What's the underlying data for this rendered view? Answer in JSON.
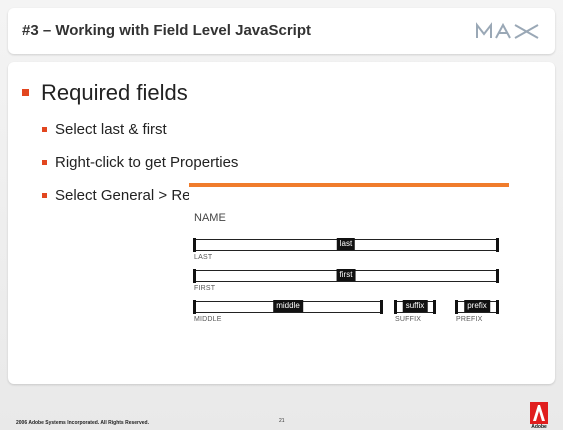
{
  "header": {
    "title": "#3 – Working with Field Level JavaScript",
    "logo": "MAX"
  },
  "content": {
    "main_bullet": "Required fields",
    "sub_bullets": [
      "Select last & first",
      "Right-click to get Properties",
      "Select General > Required"
    ]
  },
  "form": {
    "heading": "NAME",
    "fields": {
      "last": {
        "tag": "last",
        "caption": "LAST"
      },
      "first": {
        "tag": "first",
        "caption": "FIRST"
      },
      "middle": {
        "tag": "middle",
        "caption": "MIDDLE"
      },
      "suffix": {
        "tag": "suffix",
        "caption": "SUFFIX"
      },
      "prefix": {
        "tag": "prefix",
        "caption": "PREFIX"
      }
    }
  },
  "footer": {
    "copyright": "2006 Adobe Systems Incorporated.  All Rights Reserved.",
    "page_number": "21",
    "brand": "Adobe"
  },
  "colors": {
    "bullet": "#e2461f",
    "orange_rule": "#f07c2c",
    "adobe_red": "#e01e1e"
  }
}
